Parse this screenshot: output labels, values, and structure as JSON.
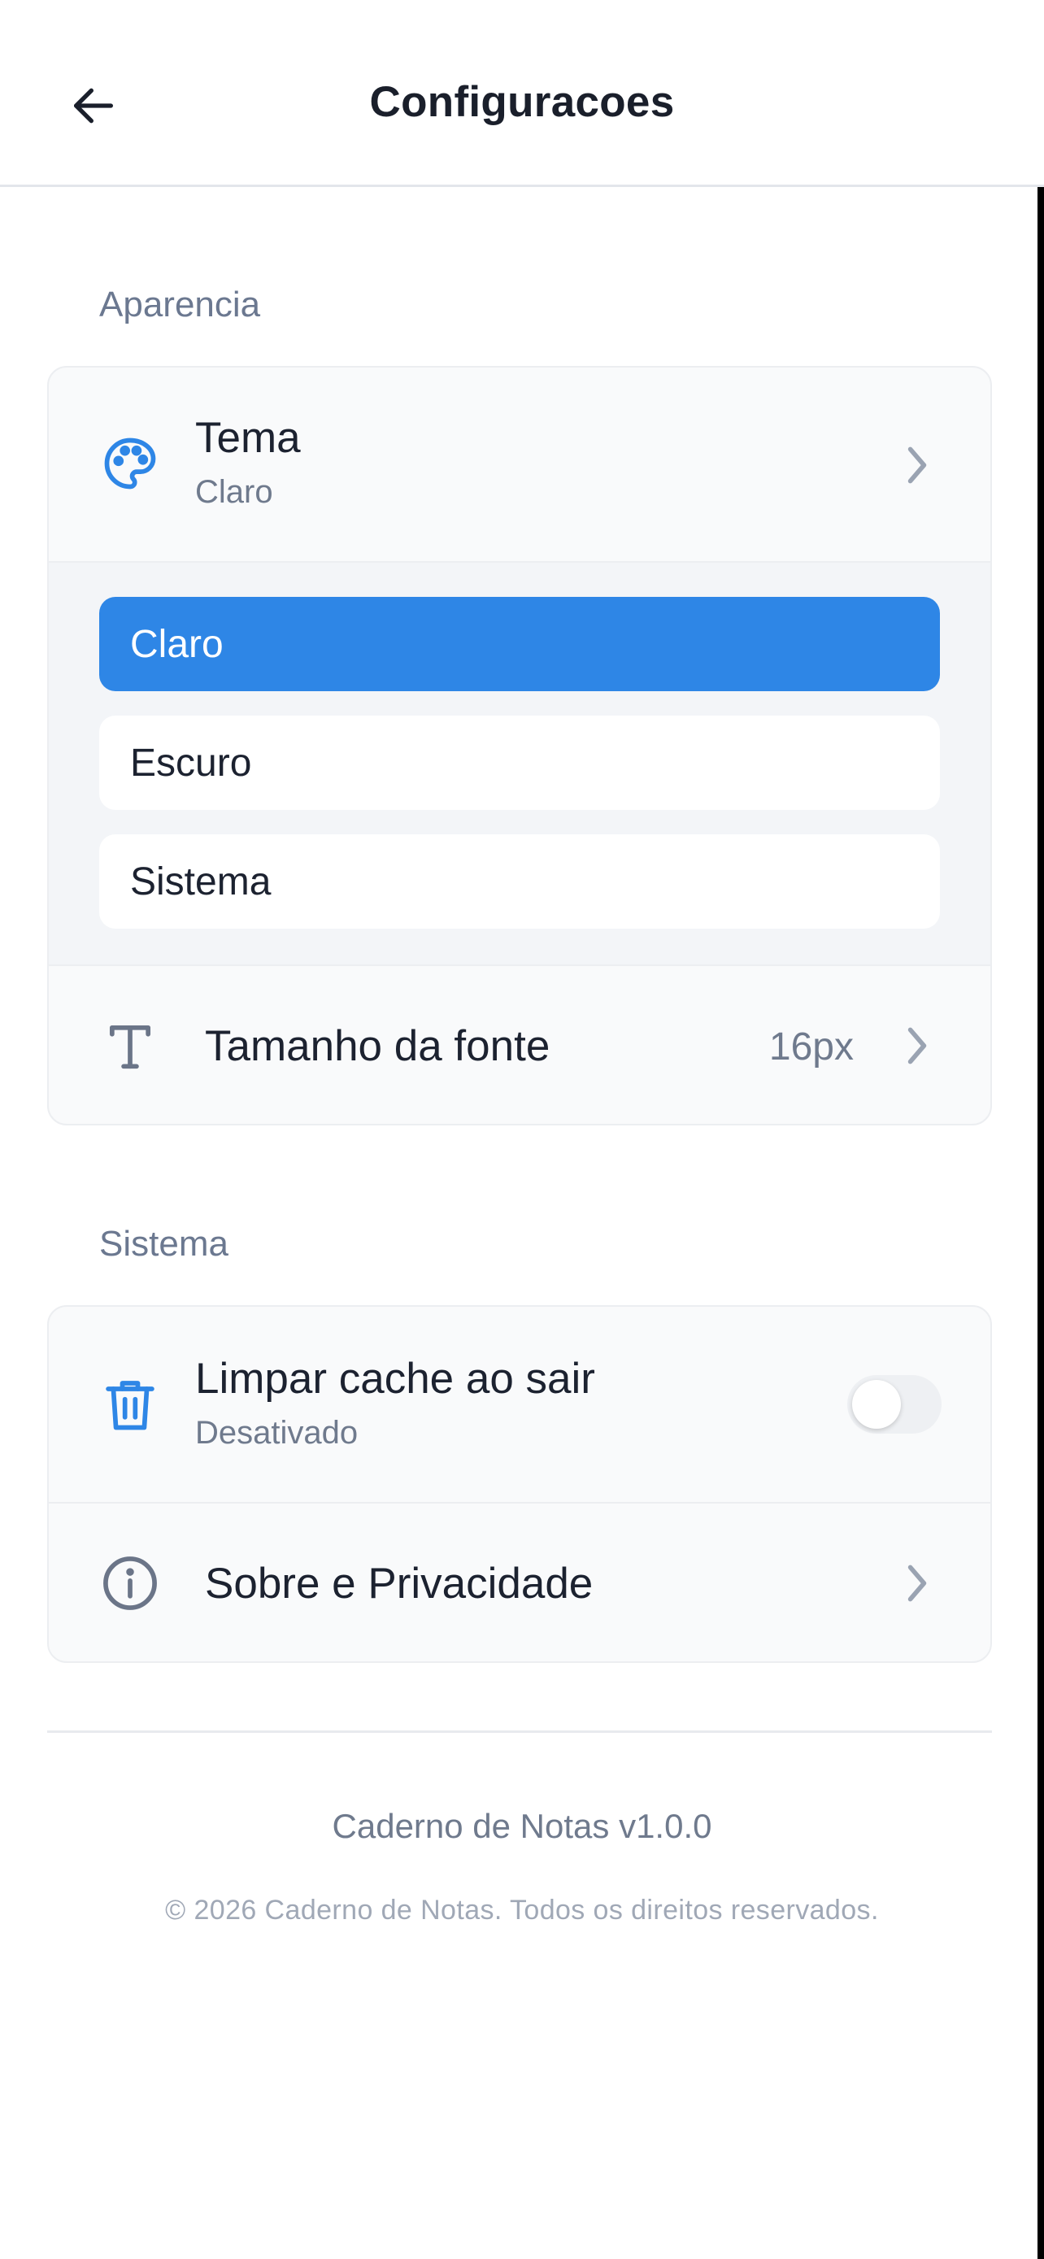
{
  "header": {
    "title": "Configuracoes",
    "back_icon": "arrow-left-icon"
  },
  "appearance": {
    "section_label": "Aparencia",
    "theme": {
      "icon": "palette-icon",
      "title": "Tema",
      "subtitle": "Claro",
      "options": [
        "Claro",
        "Escuro",
        "Sistema"
      ],
      "selected": "Claro"
    },
    "font_size": {
      "icon": "text-size-icon",
      "title": "Tamanho da fonte",
      "value": "16px"
    }
  },
  "system": {
    "section_label": "Sistema",
    "clear_cache": {
      "icon": "trash-icon",
      "title": "Limpar cache ao sair",
      "subtitle": "Desativado",
      "enabled": false
    },
    "about": {
      "icon": "info-icon",
      "title": "Sobre e Privacidade"
    }
  },
  "footer": {
    "version": "Caderno de Notas v1.0.0",
    "copyright": "© 2026 Caderno de Notas. Todos os direitos reservados."
  },
  "colors": {
    "accent": "#2e86e6",
    "icon_gray": "#6b7588",
    "muted_text": "#6f7a8d"
  }
}
